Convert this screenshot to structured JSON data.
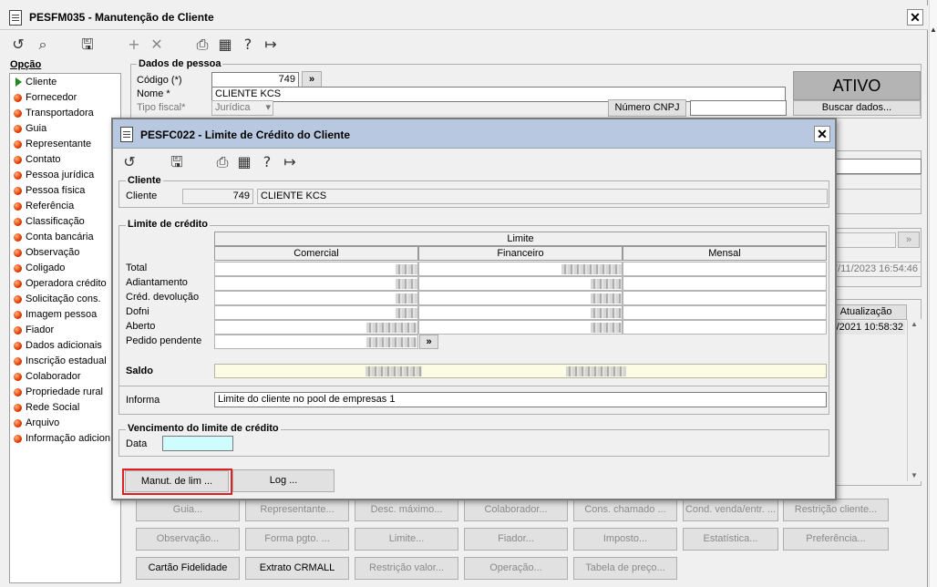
{
  "main_window": {
    "title": "PESFM035 - Manutenção de Cliente",
    "toolbar": [
      "undo-icon",
      "search-icon",
      "save-icon",
      "add-icon",
      "delete-icon",
      "print-icon",
      "calendar-icon",
      "help-icon",
      "exit-icon"
    ],
    "options_label": "Opção",
    "options": [
      "Cliente",
      "Fornecedor",
      "Transportadora",
      "Guia",
      "Representante",
      "Contato",
      "Pessoa jurídica",
      "Pessoa física",
      "Referência",
      "Classificação",
      "Conta bancária",
      "Observação",
      "Coligado",
      "Operadora crédito",
      "Solicitação cons.",
      "Imagem pessoa",
      "Fiador",
      "Dados adicionais",
      "Inscrição estadual",
      "Colaborador",
      "Propriedade rural",
      "Rede Social",
      "Arquivo",
      "Informação adicion"
    ],
    "dados_pessoa": {
      "title": "Dados de pessoa",
      "codigo_label": "Código (*)",
      "codigo_value": "749",
      "nome_label": "Nome *",
      "nome_value": "CLIENTE  KCS",
      "tipo_fiscal_label": "Tipo fiscal*",
      "tipo_fiscal_value": "Jurídica",
      "cnpj_button": "Número CNPJ",
      "status": "ATIVO",
      "buscar_button": "Buscar dados..."
    },
    "right_fragments": {
      "date1": "7/11/2023 16:54:46",
      "atualizacao_button": "Atualização",
      "date2": "/2021 10:58:32"
    },
    "bottom_buttons": [
      [
        "Guia...",
        "Representante...",
        "Desc. máximo...",
        "Colaborador...",
        "Cons. chamado ...",
        "Cond. venda/entr. ...",
        "Restrição cliente..."
      ],
      [
        "Observação...",
        "Forma pgto. ...",
        "Limite...",
        "Fiador...",
        "Imposto...",
        "Estatística...",
        "Preferência..."
      ],
      [
        "Cartão Fidelidade",
        "Extrato CRMALL",
        "Restrição valor...",
        "Operação...",
        "Tabela de preço..."
      ]
    ]
  },
  "dialog": {
    "title": "PESFC022 - Limite de Crédito do Cliente",
    "cliente_section": "Cliente",
    "cliente_label": "Cliente",
    "cliente_code": "749",
    "cliente_name": "CLIENTE  KCS",
    "limite_section": "Limite de  crédito",
    "limite_header": "Limite",
    "columns": [
      "Comercial",
      "Financeiro",
      "Mensal"
    ],
    "rows": [
      "Total",
      "Adiantamento",
      "Créd. devolução",
      "Dofni",
      "Aberto",
      "Pedido pendente"
    ],
    "pedido_button": "»",
    "saldo_label": "Saldo",
    "informa_label": "Informa",
    "informa_value": "Limite do cliente no pool de empresas 1",
    "vencimento_section": "Vencimento do limite de crédito",
    "data_label": "Data",
    "data_value": "",
    "manut_button": "Manut. de lim ...",
    "log_button": "Log ..."
  }
}
